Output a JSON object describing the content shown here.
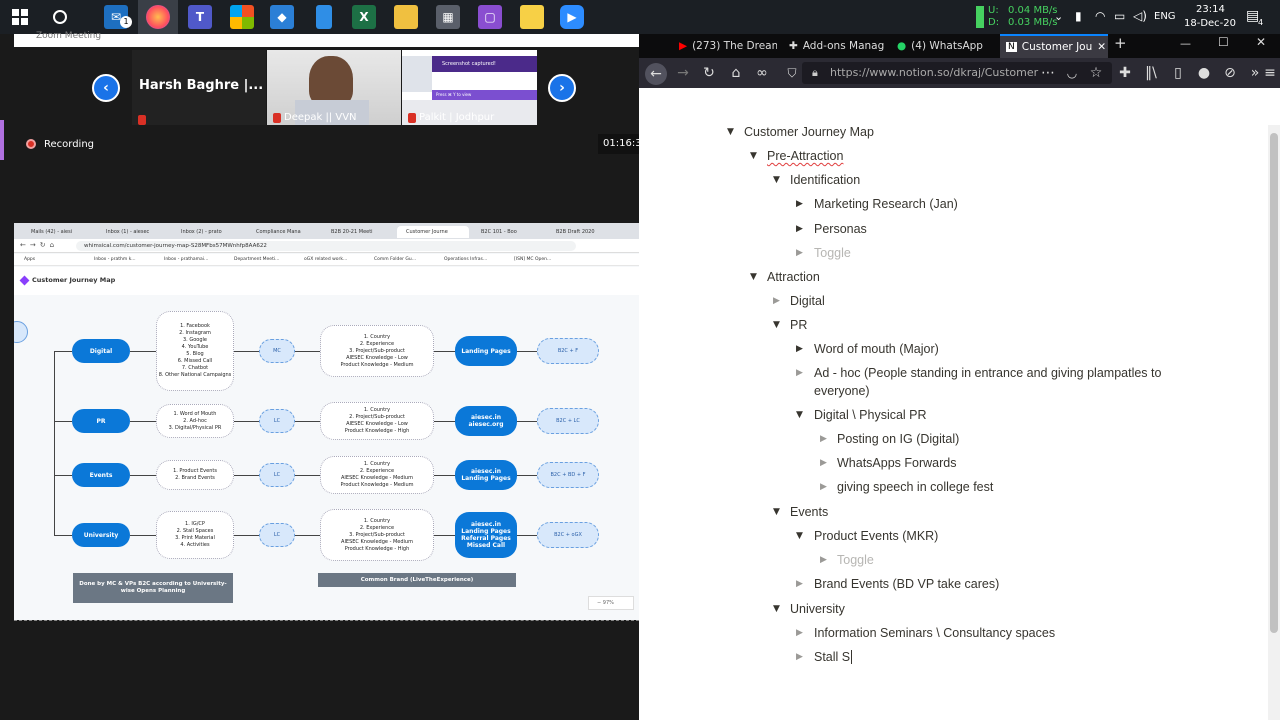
{
  "taskbar": {
    "badge_mail": "1",
    "net_up_label": "U:",
    "net_down_label": "D:",
    "net_up": "0.04 MB/s",
    "net_down": "0.03 MB/s",
    "lang": "ENG",
    "time": "23:14",
    "date": "18-Dec-20",
    "notif_count": "4"
  },
  "zoom": {
    "window_title": "Zoom Meeting",
    "speaker_name": "Harsh Baghre |...",
    "participant1": "Deepak || VVN",
    "participant2": "Palkit | Jodhpur",
    "recording": "Recording",
    "timer": "01:16:31",
    "popup_title": "Screenshot captured!",
    "popup_text": "Press ⌘ Y to view",
    "share": {
      "page_title": "Customer Journey Map",
      "url": "whimsical.com/customer-journey-map-S28MFbs57MWnhfp8AA622",
      "zoom_level": "97%",
      "tabs": [
        "Mails (42) - aiesi",
        "Inbox (1) - aiesec",
        "Inbox (2) - prato",
        "Compliance Mana",
        "B2B 20-21 Meeti",
        "Customer Journe",
        "B2C 101 - Boo",
        "B2B Draft 2020"
      ],
      "bookmarks": [
        "Apps",
        "Inbox - prathm k...",
        "Inbox - prathamai...",
        "Department Meeti...",
        "oGX related work...",
        "Comm Folder Gu...",
        "Operations Infras...",
        "[ISN] MC Open..."
      ],
      "channels": [
        "Digital",
        "PR",
        "Events",
        "University"
      ],
      "channel_items": [
        "1. Facebook\n2. Instagram\n3. Google\n4. YouTube\n5. Blog\n6. Missed Call\n7. Chatbot\n8. Other National Campaigns",
        "1. Word of Mouth\n2. Ad-hoc\n3. Digital/Physical PR",
        "1. Product Events\n2. Brand Events",
        "1. IG/CP\n2. Stall Spaces\n3. Print Material\n4. Activities"
      ],
      "owners": [
        "MC",
        "LC",
        "LC",
        "LC"
      ],
      "content": [
        "1. Country\n2. Experience\n3. Project/Sub-product\nAIESEC Knowledge - Low\nProduct Knowledge - Medium",
        "1. Country\n2. Project/Sub-product\nAIESEC Knowledge - Low\nProduct Knowledge - High",
        "1. Country\n2. Experience\nAIESEC Knowledge - Medium\nProduct Knowledge - Medium",
        "1. Country\n2. Experience\n3. Project/Sub-product\nAIESEC Knowledge - Medium\nProduct Knowledge - High"
      ],
      "landing": [
        "Landing Pages",
        "aiesec.in\naiesec.org",
        "aiesec.in\nLanding Pages",
        "aiesec.in\nLanding Pages\nReferral Pages\nMissed Call"
      ],
      "outcomes": [
        "B2C + F",
        "B2C + LC",
        "B2C + BD + F",
        "B2C + oGX"
      ],
      "footer_left": "Done by MC & VPs B2C according to University-wise Opens Planning",
      "footer_mid": "Common Brand (LiveTheExperience)"
    }
  },
  "browser": {
    "tabs": [
      "(273) The Dream",
      "Add-ons Manag",
      "(4) WhatsApp",
      "Customer Jou"
    ],
    "url": "https://www.notion.so/dkraj/Customer",
    "accent": "#0a84ff"
  },
  "notion": {
    "root": "Customer Journey Map",
    "pre_attraction": "Pre-Attraction",
    "identification": "Identification",
    "marketing_research": "Marketing Research  (Jan)",
    "personas": "Personas",
    "toggle_placeholder": "Toggle",
    "attraction": "Attraction",
    "digital": "Digital",
    "pr": "PR",
    "word_of_mouth": "Word of mouth (Major)",
    "adhoc_line1": "Ad - hoc (People standing in entrance and giving plampatles to",
    "adhoc_line2": "everyone)",
    "digital_physical": "Digital \\ Physical PR",
    "posting_ig": "Posting on IG (Digital)",
    "whatsapps": "WhatsApps Forwards",
    "speech": "giving speech in college fest",
    "events": "Events",
    "product_events": "Product Events (MKR)",
    "brand_events": "Brand Events  (BD VP take cares)",
    "university": "University",
    "info_seminars": "Information Seminars \\ Consultancy spaces",
    "stall": "Stall S"
  }
}
